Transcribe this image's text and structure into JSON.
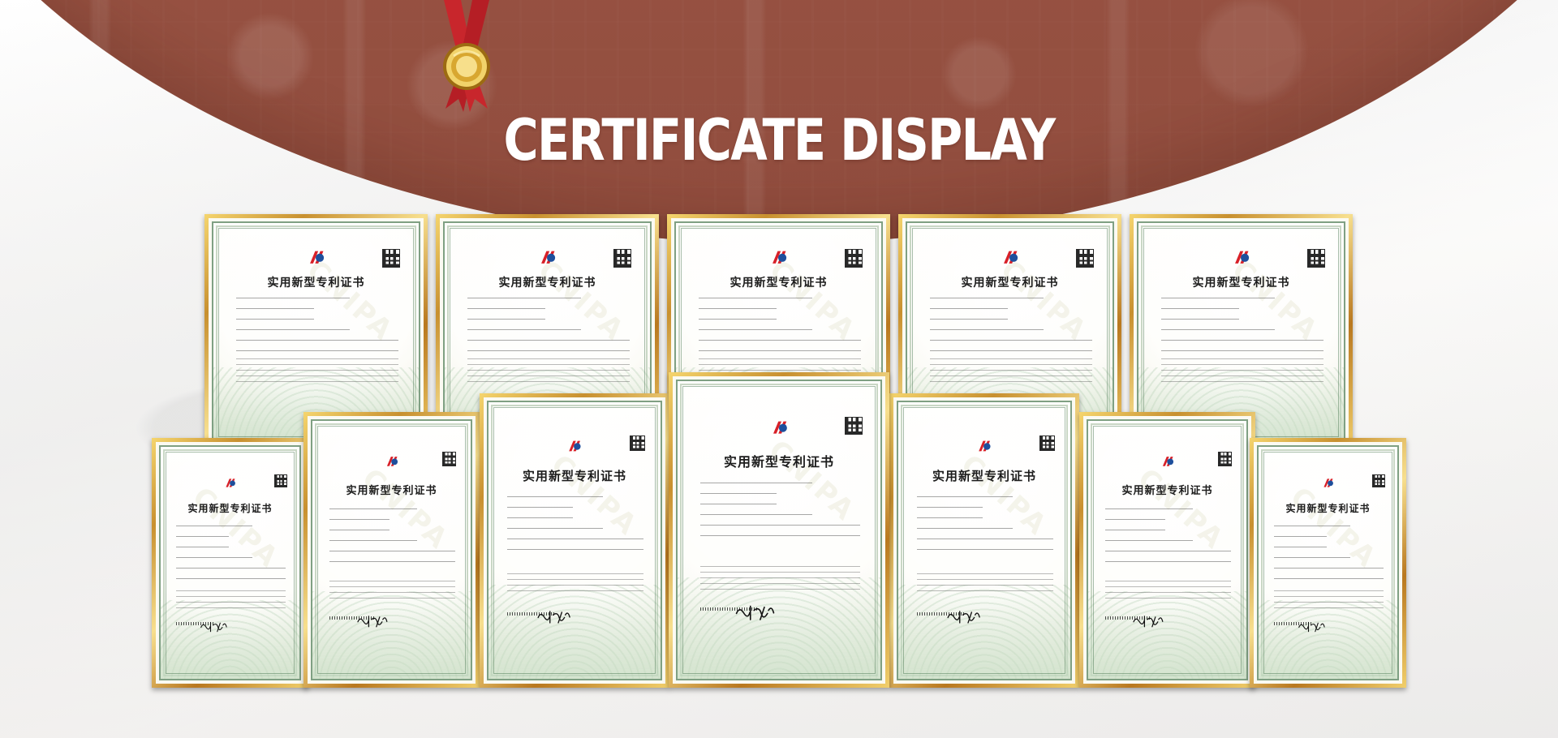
{
  "section": {
    "title": "CERTIFICATE DISPLAY"
  },
  "certificates": [
    {
      "title": "实用新型专利证书",
      "watermark": "CNIPA"
    }
  ],
  "colors": {
    "hero": "#9c5a4a",
    "frame_gold": "#d3a146",
    "paper": "#fbfaf2",
    "paper_border": "#7fa083",
    "medal_red": "#c8262c"
  }
}
